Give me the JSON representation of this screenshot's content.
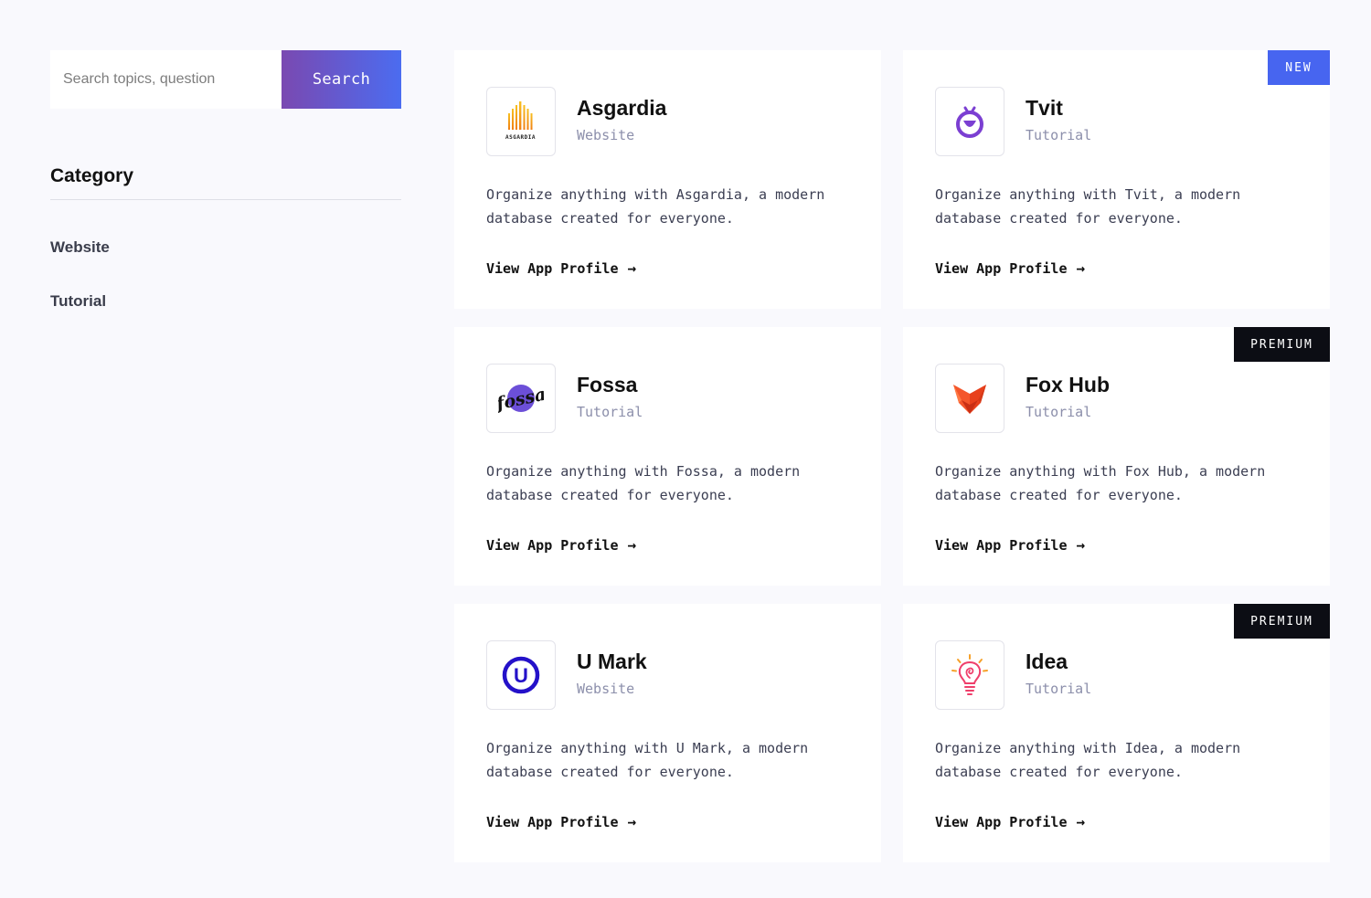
{
  "search": {
    "placeholder": "Search topics, question",
    "button_label": "Search"
  },
  "sidebar": {
    "category_title": "Category",
    "items": [
      {
        "label": "Website"
      },
      {
        "label": "Tutorial"
      }
    ]
  },
  "cards": [
    {
      "title": "Asgardia",
      "category": "Website",
      "description": "Organize anything with Asgardia, a modern database created for everyone.",
      "link_label": "View App Profile",
      "arrow": "→",
      "logo_icon": "asgardia-logo",
      "logo_text": "ASGARDIA",
      "badge": ""
    },
    {
      "title": "Tvit",
      "category": "Tutorial",
      "description": "Organize anything with Tvit, a modern database created for everyone.",
      "link_label": "View App Profile",
      "arrow": "→",
      "logo_icon": "tvit-logo",
      "badge": "NEW"
    },
    {
      "title": "Fossa",
      "category": "Tutorial",
      "description": "Organize anything with Fossa, a modern database created for everyone.",
      "link_label": "View App Profile",
      "arrow": "→",
      "logo_icon": "fossa-logo",
      "logo_text": "fossa",
      "badge": ""
    },
    {
      "title": "Fox Hub",
      "category": "Tutorial",
      "description": "Organize anything with Fox Hub, a modern database created for everyone.",
      "link_label": "View App Profile",
      "arrow": "→",
      "logo_icon": "fox-hub-logo",
      "badge": "PREMIUM"
    },
    {
      "title": "U Mark",
      "category": "Website",
      "description": "Organize anything with U Mark, a modern database created for everyone.",
      "link_label": "View App Profile",
      "arrow": "→",
      "logo_icon": "u-mark-logo",
      "logo_text": "U",
      "badge": ""
    },
    {
      "title": "Idea",
      "category": "Tutorial",
      "description": "Organize anything with Idea, a modern database created for everyone.",
      "link_label": "View App Profile",
      "arrow": "→",
      "logo_icon": "idea-lightbulb-logo",
      "badge": "PREMIUM"
    }
  ],
  "colors": {
    "accent": "#4765f0",
    "gradient_start": "#7a49b1",
    "premium_badge": "#0c0d14",
    "background": "#f9f9fd"
  }
}
